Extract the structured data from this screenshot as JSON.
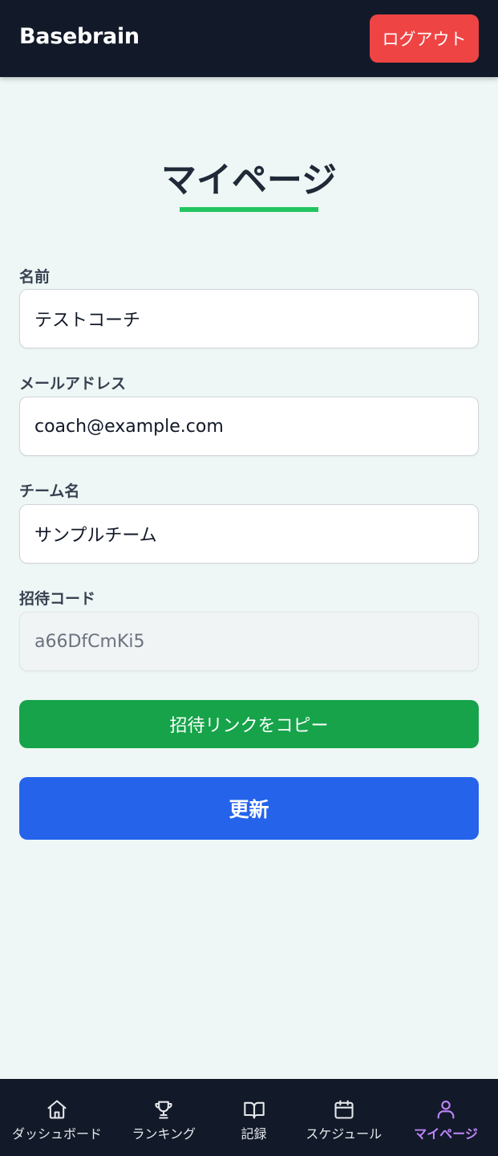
{
  "header": {
    "brand": "Basebrain",
    "logout_label": "ログアウト"
  },
  "page": {
    "title": "マイページ"
  },
  "form": {
    "name": {
      "label": "名前",
      "value": "テストコーチ"
    },
    "email": {
      "label": "メールアドレス",
      "value": "coach@example.com"
    },
    "team": {
      "label": "チーム名",
      "value": "サンプルチーム"
    },
    "invite_code": {
      "label": "招待コード",
      "value": "a66DfCmKi5"
    },
    "copy_link_label": "招待リンクをコピー",
    "update_label": "更新"
  },
  "nav": {
    "items": [
      {
        "label": "ダッシュボード",
        "icon": "home-icon"
      },
      {
        "label": "ランキング",
        "icon": "trophy-icon"
      },
      {
        "label": "記録",
        "icon": "book-icon"
      },
      {
        "label": "スケジュール",
        "icon": "calendar-icon"
      },
      {
        "label": "マイページ",
        "icon": "user-icon",
        "active": true
      }
    ]
  },
  "colors": {
    "header_bg": "#121a29",
    "page_bg": "#eef7f5",
    "logout": "#ef4444",
    "accent_green": "#22c55e",
    "copy_button": "#16a34a",
    "update_button": "#2563eb",
    "nav_active": "#c084fc"
  }
}
